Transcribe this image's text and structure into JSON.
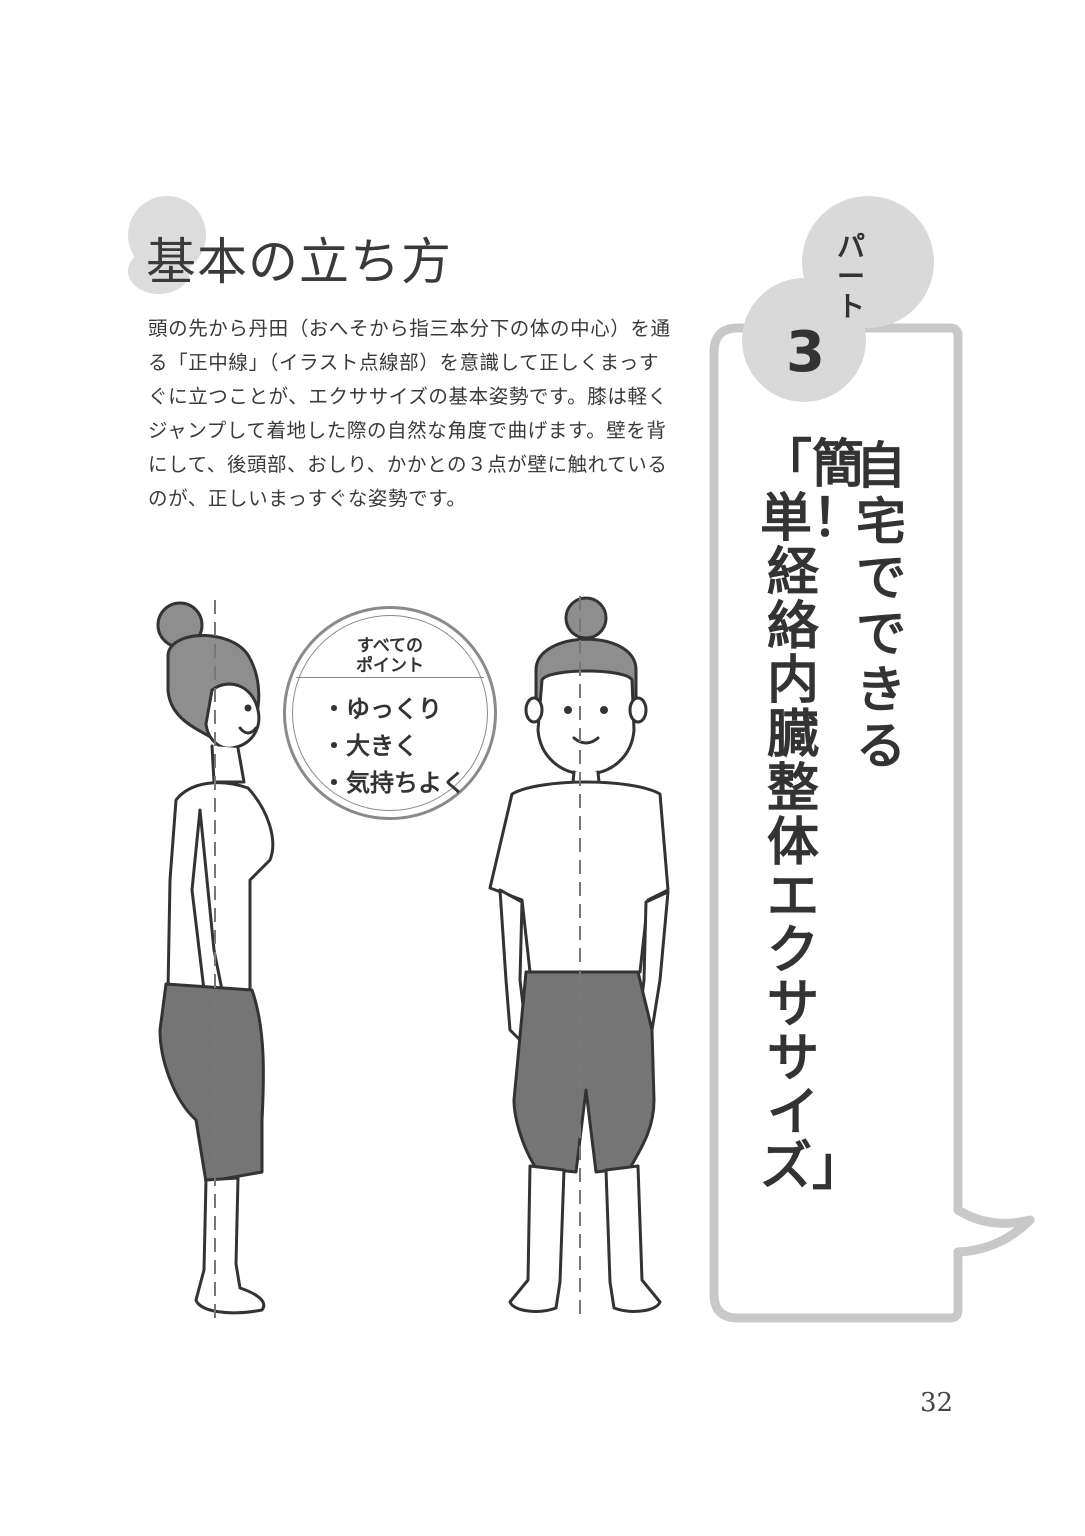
{
  "page_title": "基本の立ち方",
  "intro_text": "頭の先から丹田（おへそから指三本分下の体の中心）を通る「正中線」（イラスト点線部）を意識して正しくまっすぐに立つことが、エクササイズの基本姿勢です。膝は軽くジャンプして着地した際の自然な角度で曲げます。壁を背にして、後頭部、おしり、かかとの３点が壁に触れているのが、正しいまっすぐな姿勢です。",
  "points": {
    "heading_line1": "すべての",
    "heading_line2": "ポイント",
    "items": [
      "・ゆっくり",
      "・大きく",
      "・気持ちよく"
    ]
  },
  "part": {
    "label": "パート",
    "number": "3",
    "subtitle": "自宅でできる",
    "title": "「簡単！経絡内臓整体エクササイズ」"
  },
  "page_number": "32",
  "colors": {
    "hair": "#8e8e8e",
    "pants": "#757575",
    "bubble_border": "#c8c8c8",
    "circle_fill": "#d9d9d9"
  }
}
